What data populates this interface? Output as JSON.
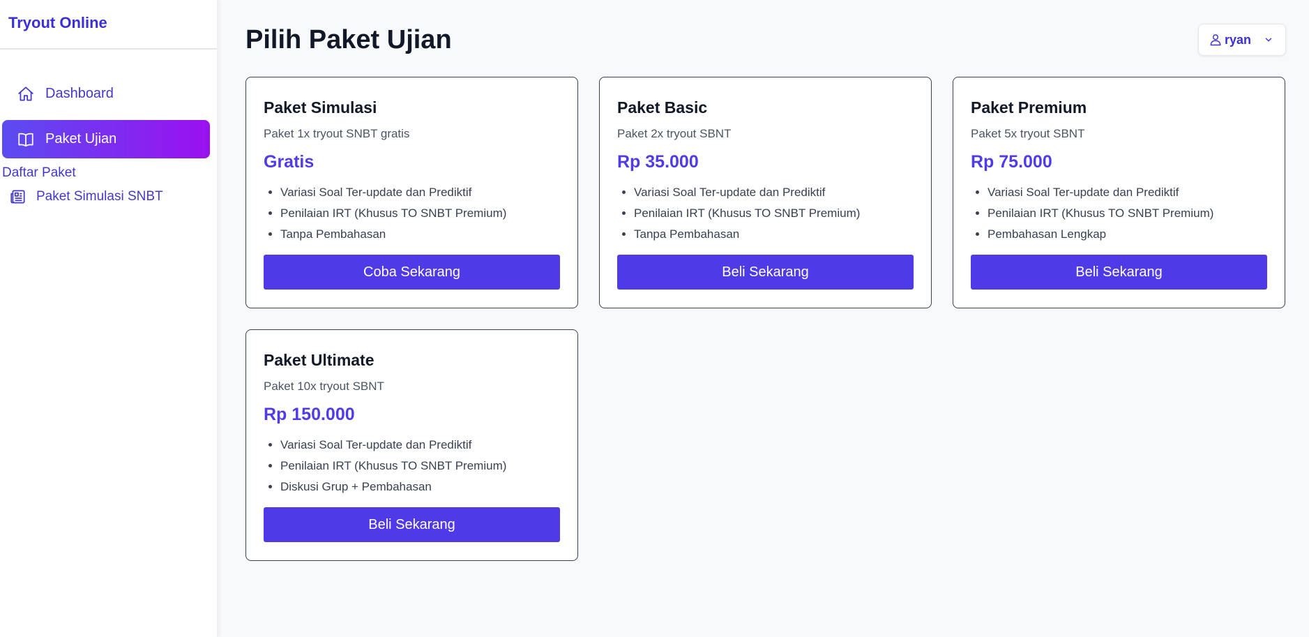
{
  "sidebar": {
    "brand": "Tryout Online",
    "nav": [
      {
        "label": "Dashboard",
        "icon": "home-icon"
      },
      {
        "label": "Paket Ujian",
        "icon": "book-open-icon",
        "active": true
      }
    ],
    "section_label": "Daftar Paket",
    "sub_items": [
      {
        "label": "Paket Simulasi SNBT",
        "icon": "newspaper-icon"
      }
    ]
  },
  "header": {
    "title": "Pilih Paket Ujian",
    "user": {
      "name": "ryan",
      "icon": "user-icon",
      "chevron": "chevron-down-icon"
    }
  },
  "packages": [
    {
      "name": "Paket Simulasi",
      "desc": "Paket 1x tryout SNBT gratis",
      "price": "Gratis",
      "features": [
        "Variasi Soal Ter-update dan Prediktif",
        "Penilaian IRT (Khusus TO SNBT Premium)",
        "Tanpa Pembahasan"
      ],
      "button": "Coba Sekarang"
    },
    {
      "name": "Paket Basic",
      "desc": "Paket 2x tryout SBNT",
      "price": "Rp 35.000",
      "features": [
        "Variasi Soal Ter-update dan Prediktif",
        "Penilaian IRT (Khusus TO SNBT Premium)",
        "Tanpa Pembahasan"
      ],
      "button": "Beli Sekarang"
    },
    {
      "name": "Paket Premium",
      "desc": "Paket 5x tryout SBNT",
      "price": "Rp 75.000",
      "features": [
        "Variasi Soal Ter-update dan Prediktif",
        "Penilaian IRT (Khusus TO SNBT Premium)",
        "Pembahasan Lengkap"
      ],
      "button": "Beli Sekarang"
    },
    {
      "name": "Paket Ultimate",
      "desc": "Paket 10x tryout SBNT",
      "price": "Rp 150.000",
      "features": [
        "Variasi Soal Ter-update dan Prediktif",
        "Penilaian IRT (Khusus TO SNBT Premium)",
        "Diskusi Grup + Pembahasan"
      ],
      "button": "Beli Sekarang"
    }
  ],
  "colors": {
    "accent": "#4f3ae8",
    "brand": "#3b2fd6",
    "active_gradient_start": "#5b4cf0",
    "active_gradient_end": "#9b10f0"
  }
}
